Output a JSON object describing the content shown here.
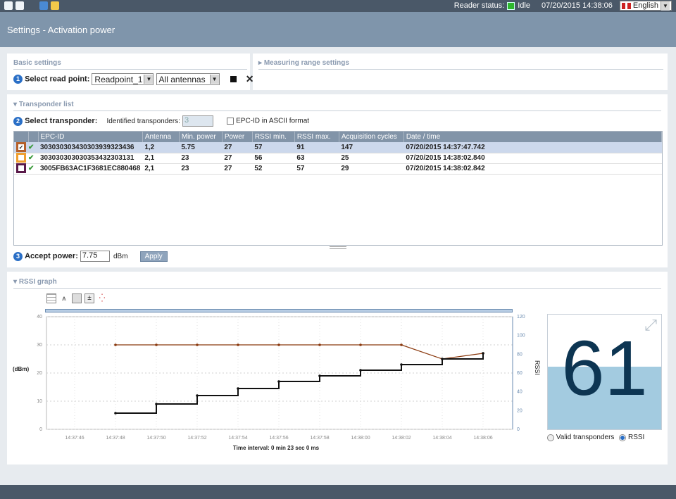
{
  "topbar": {
    "reader_status_label": "Reader status:",
    "reader_status_value": "Idle",
    "datetime": "07/20/2015 14:38:06",
    "language": "English"
  },
  "page_title": "Settings - Activation power",
  "basic_settings": {
    "heading": "Basic settings",
    "select_read_point_label": "Select read point:",
    "read_point_value": "Readpoint_1",
    "antenna_value": "All antennas"
  },
  "measuring_range": {
    "heading": "Measuring range settings"
  },
  "transponder_list": {
    "heading": "Transponder list",
    "select_label": "Select transponder:",
    "identified_label": "Identified transponders:",
    "identified_count": "3",
    "ascii_label": "EPC-ID in ASCII format",
    "columns": [
      "EPC-ID",
      "Antenna",
      "Min. power",
      "Power",
      "RSSI min.",
      "RSSI max.",
      "Acquisition cycles",
      "Date / time"
    ],
    "rows": [
      {
        "epc": "303030303430303939323436",
        "antenna": "1,2",
        "min_power": "5.75",
        "power": "27",
        "rssi_min": "57",
        "rssi_max": "91",
        "cycles": "147",
        "datetime": "07/20/2015 14:37:47.742",
        "color": "#b5602a",
        "checked": true
      },
      {
        "epc": "303030303030353432303131",
        "antenna": "2,1",
        "min_power": "23",
        "power": "27",
        "rssi_min": "56",
        "rssi_max": "63",
        "cycles": "25",
        "datetime": "07/20/2015 14:38:02.840",
        "color": "#f0a030",
        "checked": false
      },
      {
        "epc": "3005FB63AC1F3681EC880468",
        "antenna": "2,1",
        "min_power": "23",
        "power": "27",
        "rssi_min": "52",
        "rssi_max": "57",
        "cycles": "29",
        "datetime": "07/20/2015 14:38:02.842",
        "color": "#5a1a4a",
        "checked": false
      }
    ],
    "accept_power_label": "Accept power:",
    "accept_power_value": "7.75",
    "accept_power_unit": "dBm",
    "apply_label": "Apply"
  },
  "rssi_graph": {
    "heading": "RSSI graph",
    "y_left_label": "(dBm)",
    "y_right_label": "RSSI",
    "y_left_ticks": [
      "40",
      "30",
      "20",
      "10",
      "0"
    ],
    "y_right_ticks": [
      "120",
      "100",
      "80",
      "60",
      "40",
      "20",
      "0"
    ],
    "x_ticks": [
      "14:37:46",
      "14:37:48",
      "14:37:50",
      "14:37:52",
      "14:37:54",
      "14:37:56",
      "14:37:58",
      "14:38:00",
      "14:38:02",
      "14:38:04",
      "14:38:06"
    ],
    "time_interval": "Time interval: 0 min 23 sec 0 ms",
    "big_value": "61",
    "big_value_fill": 0.61,
    "radio_valid": "Valid transponders",
    "radio_rssi": "RSSI",
    "colors": {
      "power_line": "#8b3a0f",
      "step_line": "#111111",
      "gauge_fill": "#a3cbe0",
      "gauge_text": "#0d3552"
    }
  },
  "chart_data": {
    "type": "line",
    "x": [
      "14:37:48",
      "14:37:50",
      "14:37:52",
      "14:37:54",
      "14:37:56",
      "14:37:58",
      "14:38:00",
      "14:38:02",
      "14:38:04",
      "14:38:06"
    ],
    "series": [
      {
        "values": [
          30,
          30,
          30,
          30,
          30,
          30,
          30,
          30,
          25,
          27
        ]
      },
      {
        "values": [
          5.75,
          9,
          12,
          14.5,
          17,
          19,
          21,
          23,
          25,
          27
        ]
      }
    ],
    "ylabel": "(dBm)",
    "ylim": [
      0,
      40
    ],
    "y2label": "RSSI",
    "y2lim": [
      0,
      120
    ]
  }
}
